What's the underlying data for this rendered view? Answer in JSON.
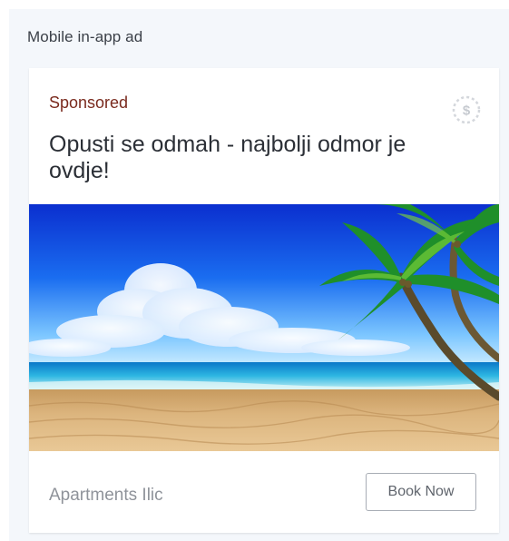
{
  "frame": {
    "title": "Mobile in-app ad"
  },
  "ad": {
    "sponsored_label": "Sponsored",
    "headline": "Opusti se odmah - najbolji odmor je ovdje!",
    "badge_symbol": "$",
    "advertiser": "Apartments Ilic",
    "cta_label": "Book Now",
    "image_icon": "beach-palm-image"
  },
  "colors": {
    "frame_background": "#f4f7fb",
    "sponsored_text": "#7a2a1e",
    "headline_text": "#2b2f36",
    "advertiser_text": "#8f939a",
    "button_border": "#a8adb5"
  }
}
